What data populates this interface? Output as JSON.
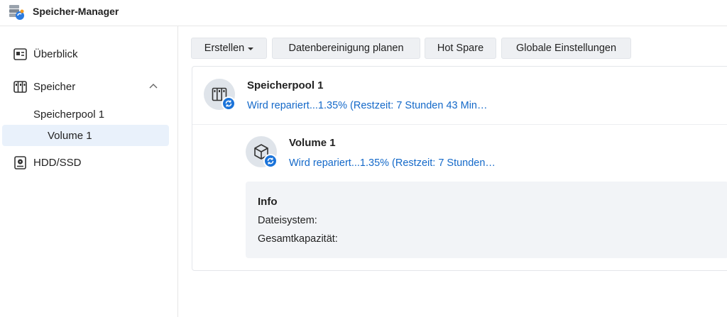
{
  "app": {
    "title": "Speicher-Manager"
  },
  "sidebar": {
    "items": [
      {
        "label": "Überblick",
        "icon": "overview-icon"
      },
      {
        "label": "Speicher",
        "icon": "storage-icon",
        "expanded": true,
        "children": [
          {
            "label": "Speicherpool 1"
          },
          {
            "label": "Volume 1",
            "selected": true
          }
        ]
      },
      {
        "label": "HDD/SSD",
        "icon": "hdd-icon"
      }
    ]
  },
  "toolbar": {
    "create": "Erstellen",
    "schedule_scrub": "Datenbereinigung planen",
    "hot_spare": "Hot Spare",
    "global_settings": "Globale Einstellungen"
  },
  "pool": {
    "title": "Speicherpool 1",
    "status": "Wird repariert...1.35% (Restzeit: 7 Stunden 43 Min…"
  },
  "volume": {
    "title": "Volume 1",
    "status": "Wird repariert...1.35% (Restzeit: 7 Stunden…"
  },
  "info": {
    "title": "Info",
    "filesystem_label": "Dateisystem:",
    "capacity_label": "Gesamtkapazität:"
  },
  "colors": {
    "accent": "#1a73d9",
    "status_text": "#1469c9",
    "selected_bg": "#e9f1fb"
  }
}
